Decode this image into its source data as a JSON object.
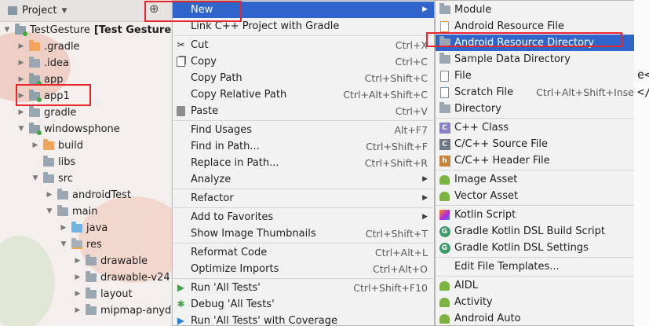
{
  "project_pane": {
    "title": "Project",
    "tree": [
      {
        "label": "TestGesture",
        "bold_suffix": "[Test Gesture]",
        "hint": "E:\\",
        "indent": 0,
        "arrow": "▼",
        "icon": "module-folder"
      },
      {
        "label": ".gradle",
        "indent": 1,
        "arrow": "▶",
        "icon": "orange-folder"
      },
      {
        "label": ".idea",
        "indent": 1,
        "arrow": "▶",
        "icon": "gray-folder"
      },
      {
        "label": "app",
        "indent": 1,
        "arrow": "▶",
        "icon": "module-folder"
      },
      {
        "label": "app1",
        "indent": 1,
        "arrow": "▶",
        "icon": "module-folder"
      },
      {
        "label": "gradle",
        "indent": 1,
        "arrow": "▶",
        "icon": "gray-folder"
      },
      {
        "label": "windowsphone",
        "indent": 1,
        "arrow": "▼",
        "icon": "module-folder"
      },
      {
        "label": "build",
        "indent": 2,
        "arrow": "▶",
        "icon": "orange-folder"
      },
      {
        "label": "libs",
        "indent": 2,
        "arrow": "",
        "icon": "gray-folder"
      },
      {
        "label": "src",
        "indent": 2,
        "arrow": "▼",
        "icon": "gray-folder"
      },
      {
        "label": "androidTest",
        "indent": 3,
        "arrow": "▶",
        "icon": "gray-folder"
      },
      {
        "label": "main",
        "indent": 3,
        "arrow": "▼",
        "icon": "gray-folder"
      },
      {
        "label": "java",
        "indent": 4,
        "arrow": "▶",
        "icon": "blue-folder"
      },
      {
        "label": "res",
        "indent": 4,
        "arrow": "▼",
        "icon": "res-folder"
      },
      {
        "label": "drawable",
        "indent": 5,
        "arrow": "▶",
        "icon": "gray-folder"
      },
      {
        "label": "drawable-v24",
        "indent": 5,
        "arrow": "▶",
        "icon": "gray-folder"
      },
      {
        "label": "layout",
        "indent": 5,
        "arrow": "▶",
        "icon": "gray-folder"
      },
      {
        "label": "mipmap-anydp",
        "indent": 5,
        "arrow": "▶",
        "icon": "gray-folder"
      }
    ]
  },
  "context_menu": {
    "items": [
      {
        "label": "New",
        "shortcut": "",
        "submenu": true,
        "selected": true,
        "icon": ""
      },
      {
        "label": "Link C++ Project with Gradle",
        "shortcut": "",
        "icon": ""
      },
      {
        "sep": true
      },
      {
        "label": "Cut",
        "shortcut": "Ctrl+X",
        "icon": "scissors-icon"
      },
      {
        "label": "Copy",
        "shortcut": "Ctrl+C",
        "icon": "copy-icon"
      },
      {
        "label": "Copy Path",
        "shortcut": "Ctrl+Shift+C",
        "icon": ""
      },
      {
        "label": "Copy Relative Path",
        "shortcut": "Ctrl+Alt+Shift+C",
        "icon": ""
      },
      {
        "label": "Paste",
        "shortcut": "Ctrl+V",
        "icon": "paste-icon"
      },
      {
        "sep": true
      },
      {
        "label": "Find Usages",
        "shortcut": "Alt+F7",
        "icon": ""
      },
      {
        "label": "Find in Path...",
        "shortcut": "Ctrl+Shift+F",
        "icon": ""
      },
      {
        "label": "Replace in Path...",
        "shortcut": "Ctrl+Shift+R",
        "icon": ""
      },
      {
        "label": "Analyze",
        "shortcut": "",
        "submenu": true,
        "icon": ""
      },
      {
        "sep": true
      },
      {
        "label": "Refactor",
        "shortcut": "",
        "submenu": true,
        "icon": ""
      },
      {
        "sep": true
      },
      {
        "label": "Add to Favorites",
        "shortcut": "",
        "submenu": true,
        "icon": ""
      },
      {
        "label": "Show Image Thumbnails",
        "shortcut": "Ctrl+Shift+T",
        "icon": ""
      },
      {
        "sep": true
      },
      {
        "label": "Reformat Code",
        "shortcut": "Ctrl+Alt+L",
        "icon": ""
      },
      {
        "label": "Optimize Imports",
        "shortcut": "Ctrl+Alt+O",
        "icon": ""
      },
      {
        "sep": true
      },
      {
        "label": "Run 'All Tests'",
        "shortcut": "Ctrl+Shift+F10",
        "icon": "run-icon"
      },
      {
        "label": "Debug 'All Tests'",
        "shortcut": "",
        "icon": "debug-icon"
      },
      {
        "label": "Run 'All Tests' with Coverage",
        "shortcut": "",
        "icon": "coverage-icon"
      }
    ]
  },
  "new_submenu": {
    "items": [
      {
        "label": "Module",
        "shortcut": "",
        "icon": "folder-icon"
      },
      {
        "label": "Android Resource File",
        "shortcut": "",
        "icon": "android-file-icon"
      },
      {
        "label": "Android Resource Directory",
        "shortcut": "",
        "icon": "folder-icon",
        "selected": true
      },
      {
        "label": "Sample Data Directory",
        "shortcut": "",
        "icon": "folder-icon"
      },
      {
        "label": "File",
        "shortcut": "",
        "icon": "file-icon"
      },
      {
        "label": "Scratch File",
        "shortcut": "Ctrl+Alt+Shift+Insert",
        "icon": "scratch-icon"
      },
      {
        "label": "Directory",
        "shortcut": "",
        "icon": "folder-icon"
      },
      {
        "sep": true
      },
      {
        "label": "C++ Class",
        "shortcut": "",
        "icon": "cpp-class-icon"
      },
      {
        "label": "C/C++ Source File",
        "shortcut": "",
        "icon": "cpp-source-icon"
      },
      {
        "label": "C/C++ Header File",
        "shortcut": "",
        "icon": "cpp-header-icon"
      },
      {
        "sep": true
      },
      {
        "label": "Image Asset",
        "shortcut": "",
        "icon": "android-icon"
      },
      {
        "label": "Vector Asset",
        "shortcut": "",
        "icon": "android-icon"
      },
      {
        "sep": true
      },
      {
        "label": "Kotlin Script",
        "shortcut": "",
        "icon": "kotlin-icon"
      },
      {
        "label": "Gradle Kotlin DSL Build Script",
        "shortcut": "",
        "icon": "gradle-icon"
      },
      {
        "label": "Gradle Kotlin DSL Settings",
        "shortcut": "",
        "icon": "gradle-icon"
      },
      {
        "sep": true
      },
      {
        "label": "Edit File Templates...",
        "shortcut": "",
        "icon": ""
      },
      {
        "sep": true
      },
      {
        "label": "AIDL",
        "shortcut": "",
        "submenu": true,
        "icon": "android-icon"
      },
      {
        "label": "Activity",
        "shortcut": "",
        "submenu": true,
        "icon": "android-icon"
      },
      {
        "label": "Android Auto",
        "shortcut": "",
        "submenu": true,
        "icon": "android-icon"
      }
    ]
  },
  "editor_fragment": {
    "line1": "e<",
    "line2": "</"
  },
  "colors": {
    "selection": "#2f65ca",
    "highlight_box": "#e6262c"
  }
}
